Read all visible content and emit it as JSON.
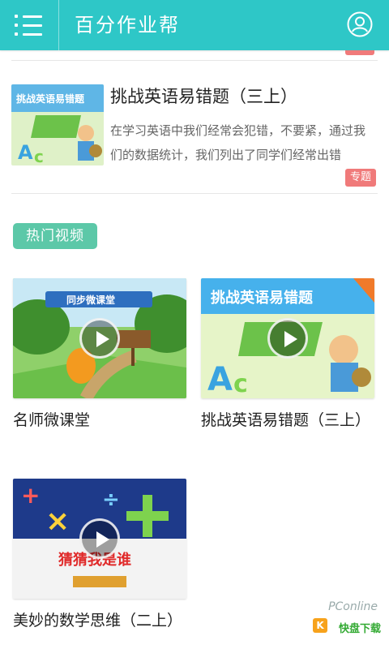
{
  "header": {
    "title": "百分作业帮",
    "menu_icon": "menu-icon",
    "user_icon": "user-icon",
    "bg_color": "#2ec7c7"
  },
  "article": {
    "thumb_title": "挑战英语易错题",
    "title": "挑战英语易错题（三上）",
    "description": "在学习英语中我们经常会犯错，不要紧，通过我们的数据统计，我们列出了同学们经常出错",
    "tag": "专题"
  },
  "section": {
    "label": "热门视频"
  },
  "videos": [
    {
      "title": "名师微课堂",
      "thumb_banner": "同步微课堂"
    },
    {
      "title": "挑战英语易错题（三上）",
      "thumb_banner": "挑战英语易错题"
    },
    {
      "title": "美妙的数学思维（二上）",
      "thumb_banner": "猜猜我是谁"
    }
  ],
  "watermark": {
    "brand": "PConline",
    "logo": "快盘下载",
    "logo_mark": "K"
  }
}
